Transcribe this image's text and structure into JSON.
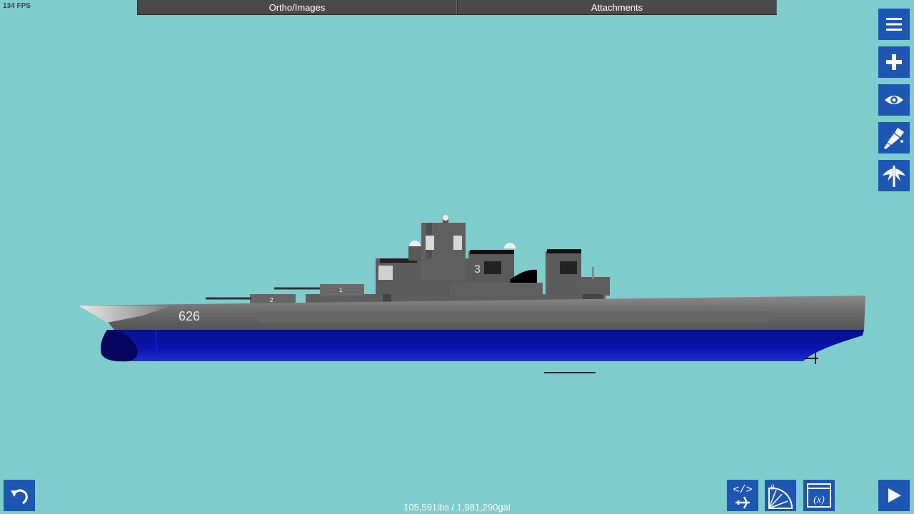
{
  "fps": "134 FPS",
  "tabs": [
    {
      "label": "Ortho/Images"
    },
    {
      "label": "Attachments"
    }
  ],
  "side_toolbar": [
    {
      "icon": "menu-icon"
    },
    {
      "icon": "plus-icon"
    },
    {
      "icon": "eye-icon"
    },
    {
      "icon": "paint-brush-icon"
    },
    {
      "icon": "wings-icon"
    }
  ],
  "bottom_toolbar": [
    {
      "icon": "undo-icon"
    },
    {
      "icon": "code-aircraft-icon"
    },
    {
      "icon": "theta-protractor-icon"
    },
    {
      "icon": "variables-icon"
    },
    {
      "icon": "play-icon"
    }
  ],
  "ship": {
    "hull_number": "626",
    "turret_1": "1",
    "turret_2": "2",
    "superstructure_number": "3"
  },
  "status": "105,591lbs / 1,981,290gal",
  "colors": {
    "background": "#7fcccc",
    "button": "#1d57b3",
    "hull_upper": "#6a6a6a",
    "hull_lower": "#0a12a0"
  }
}
